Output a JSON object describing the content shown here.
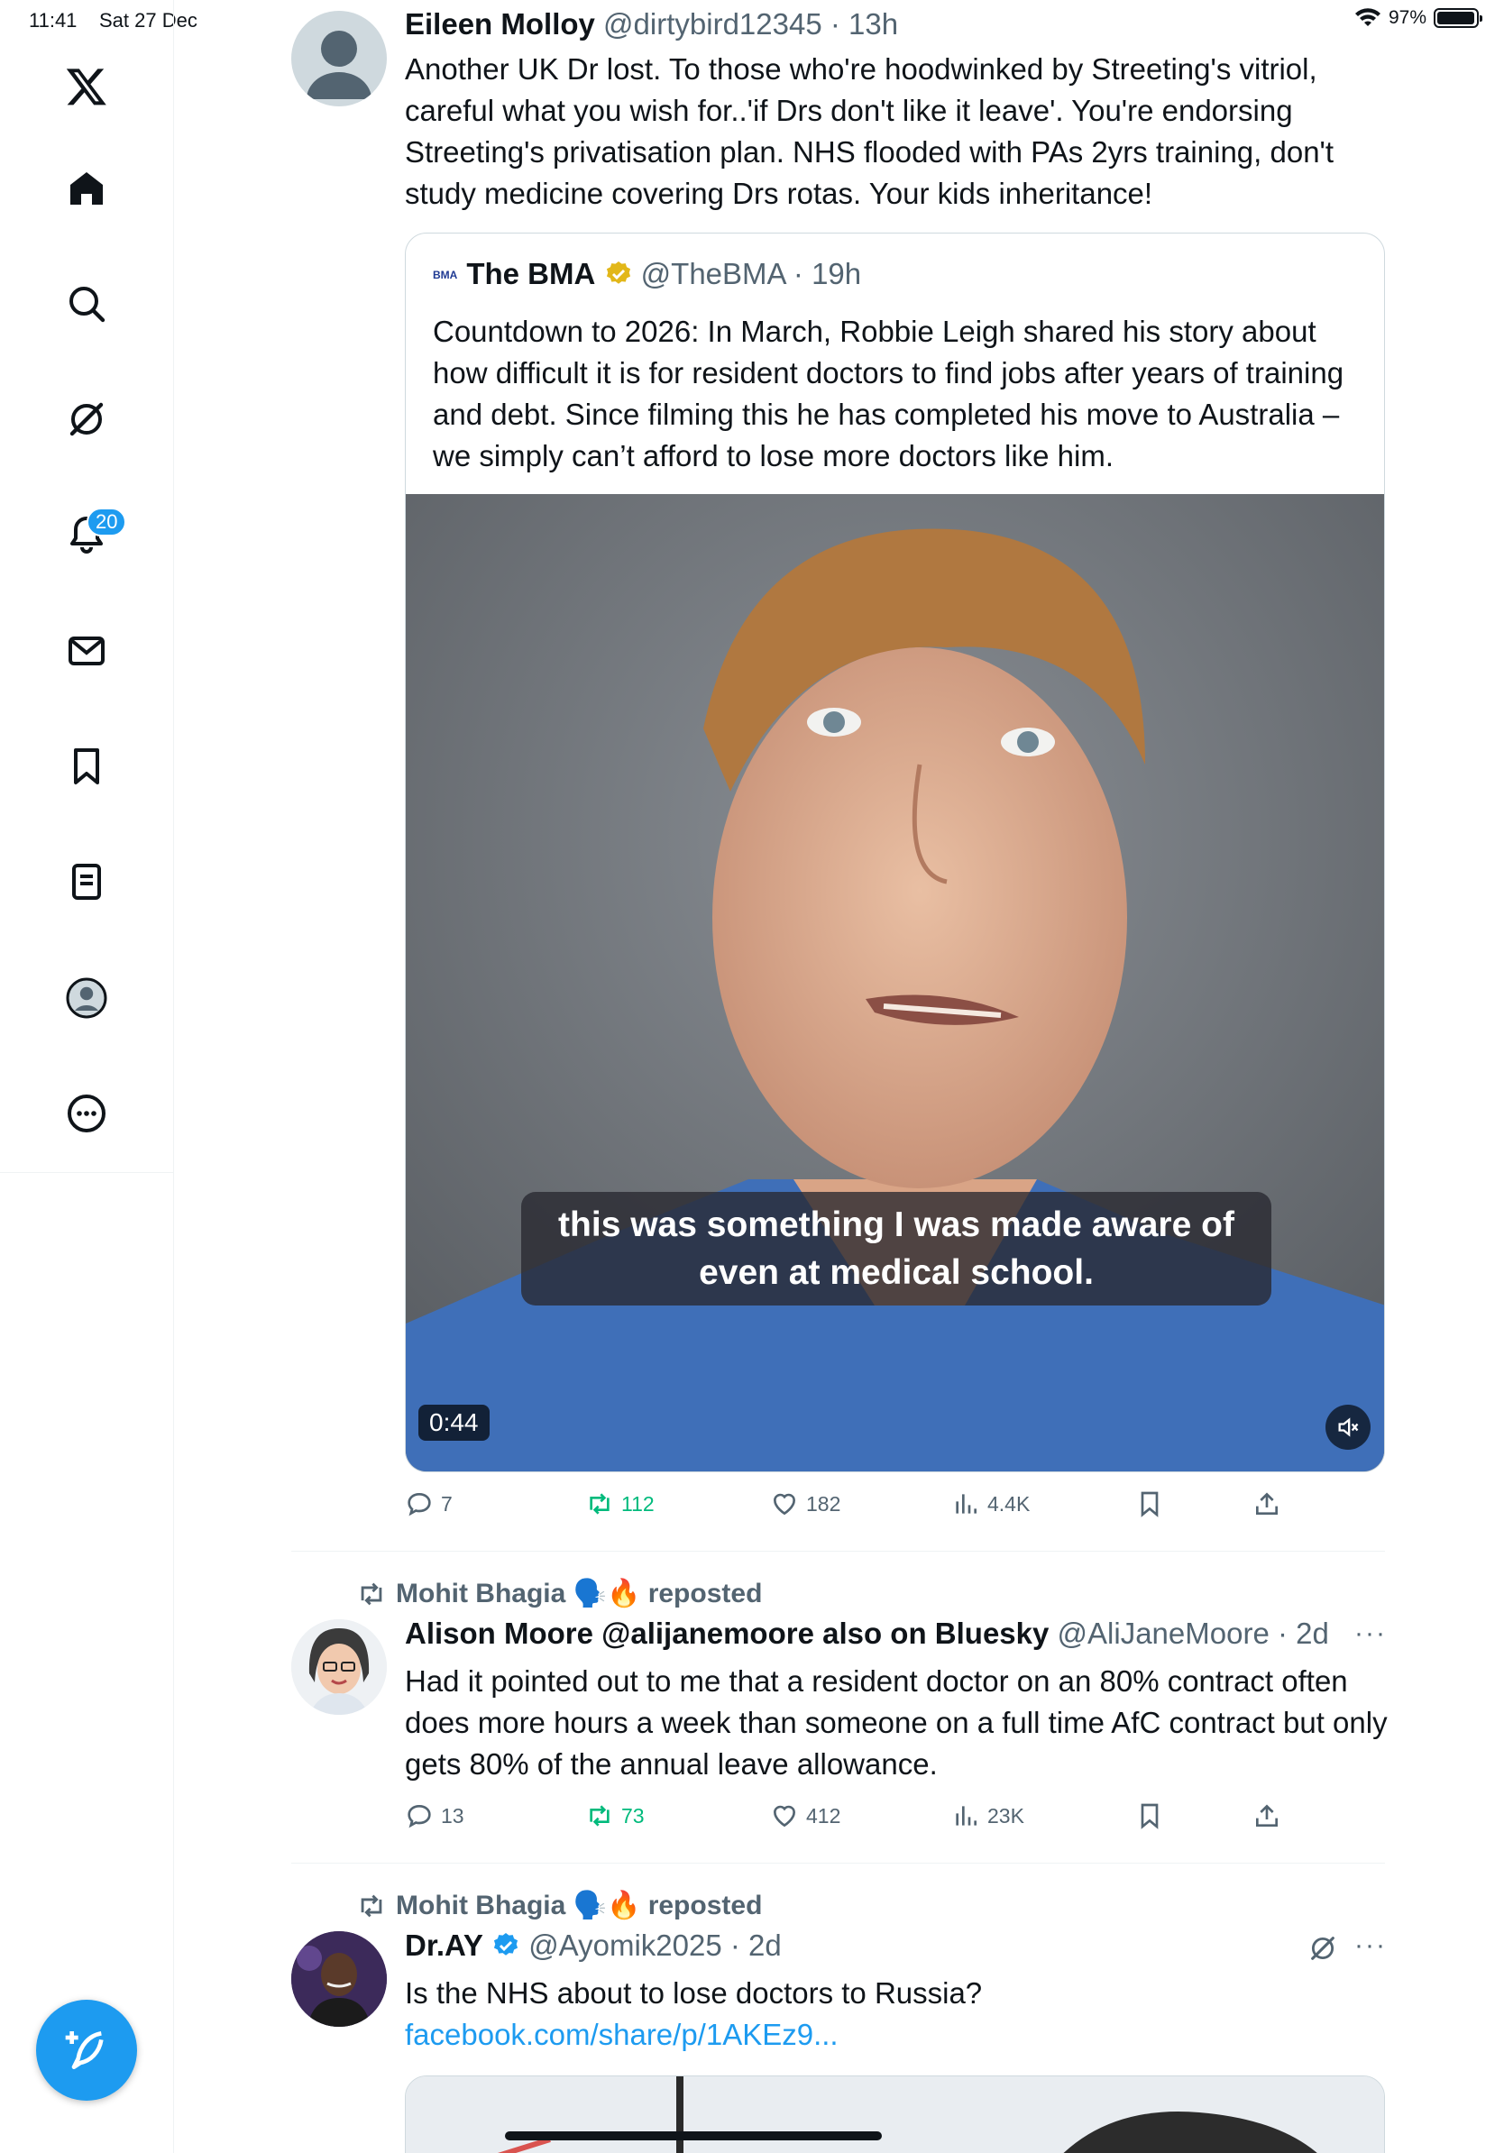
{
  "status_bar": {
    "time": "11:41",
    "date": "Sat 27 Dec",
    "battery": "97%",
    "battery_level": 0.97
  },
  "sidebar": {
    "items": [
      {
        "name": "home"
      },
      {
        "name": "explore"
      },
      {
        "name": "grok"
      },
      {
        "name": "notifications",
        "badge": "20"
      },
      {
        "name": "messages"
      },
      {
        "name": "bookmarks"
      },
      {
        "name": "lists"
      },
      {
        "name": "profile"
      },
      {
        "name": "more"
      }
    ]
  },
  "tweets": [
    {
      "name": "Eileen Molloy",
      "handle": "@dirtybird12345",
      "time": "· 13h",
      "text": "Another UK Dr lost. To those who're hoodwinked by Streeting's vitriol, careful what you wish for..'if Drs don't like it leave'. You're endorsing Streeting's privatisation plan. NHS flooded with PAs 2yrs training, don't study medicine covering Drs rotas. Your kids inheritance!",
      "quote": {
        "name": "The BMA",
        "logo_text": "BMA",
        "handle": "@TheBMA",
        "time": "· 19h",
        "text": "Countdown to 2026: In March, Robbie Leigh shared his story about how difficult it is for resident doctors to find jobs after years of training and debt. Since filming this he has completed his move to Australia – we simply can’t afford to lose more doctors like him.",
        "video_caption": "this was something I was made aware of even at medical school.",
        "duration": "0:44"
      },
      "stats": {
        "replies": "7",
        "reposts": "112",
        "likes": "182",
        "views": "4.4K"
      }
    },
    {
      "reposted_by": "Mohit Bhagia 🗣️🔥 reposted",
      "name": "Alison Moore @alijanemoore also on Bluesky",
      "handle": "@AliJaneMoore",
      "time": "· 2d",
      "text": "Had it pointed out to me that a resident doctor on an 80% contract often does more hours a week than someone on a full time AfC contract but only gets 80% of the annual leave allowance.",
      "stats": {
        "replies": "13",
        "reposts": "73",
        "likes": "412",
        "views": "23K"
      }
    },
    {
      "reposted_by": "Mohit Bhagia 🗣️🔥 reposted",
      "name": "Dr.AY",
      "handle": "@Ayomik2025",
      "time": "· 2d",
      "text": "Is the NHS about to lose doctors to Russia?",
      "link": "facebook.com/share/p/1AKEz9..."
    }
  ],
  "more_menu": "···",
  "colors": {
    "accent": "#1d9bf0",
    "repost_green": "#00ba7c",
    "muted": "#536471",
    "verified_gold": "#e2b719"
  }
}
